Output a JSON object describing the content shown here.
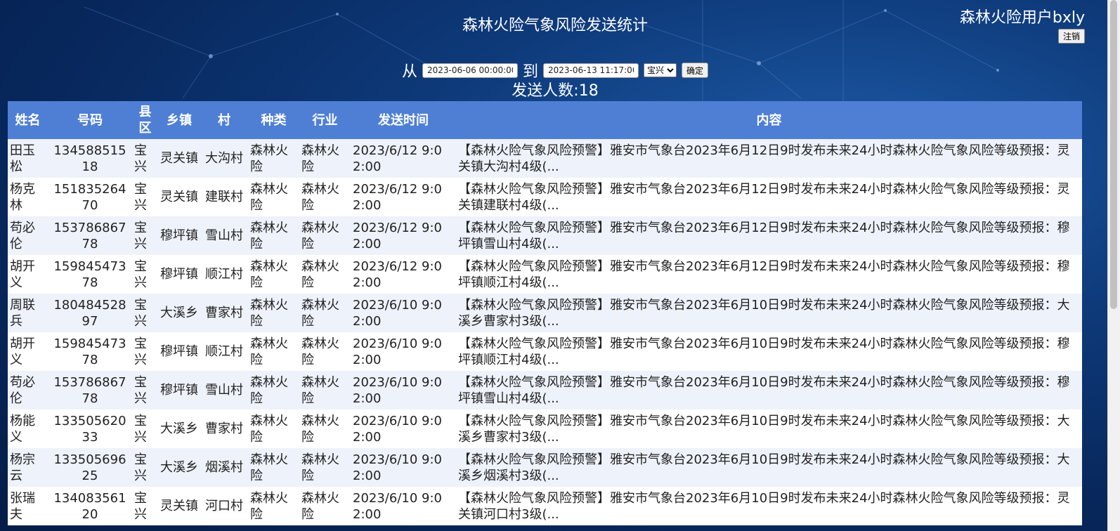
{
  "page": {
    "title": "森林火险气象风险发送统计",
    "user_name": "森林火险用户bxly",
    "logout_label": "注销"
  },
  "filter": {
    "from_label": "从",
    "to_label": "到",
    "start_value": "2023-06-06 00:00:00",
    "end_value": "2023-06-13 11:17:00",
    "county_selected": "宝兴",
    "confirm_label": "确定"
  },
  "summary": {
    "count_text": "发送人数:18"
  },
  "table": {
    "headers": [
      "姓名",
      "号码",
      "县区",
      "乡镇",
      "村",
      "种类",
      "行业",
      "发送时间",
      "内容"
    ],
    "rows": [
      {
        "name": "田玉松",
        "phone": "13458851518",
        "county": "宝兴",
        "town": "灵关镇",
        "village": "大沟村",
        "kind": "森林火险",
        "industry": "森林火险",
        "time": "2023/6/12 9:02:00",
        "content": "【森林火险气象风险预警】雅安市气象台2023年6月12日9时发布未来24小时森林火险气象风险等级预报：灵关镇大沟村4级(..."
      },
      {
        "name": "杨克林",
        "phone": "15183526470",
        "county": "宝兴",
        "town": "灵关镇",
        "village": "建联村",
        "kind": "森林火险",
        "industry": "森林火险",
        "time": "2023/6/12 9:02:00",
        "content": "【森林火险气象风险预警】雅安市气象台2023年6月12日9时发布未来24小时森林火险气象风险等级预报：灵关镇建联村4级(..."
      },
      {
        "name": "苟必伦",
        "phone": "15378686778",
        "county": "宝兴",
        "town": "穆坪镇",
        "village": "雪山村",
        "kind": "森林火险",
        "industry": "森林火险",
        "time": "2023/6/12 9:02:00",
        "content": "【森林火险气象风险预警】雅安市气象台2023年6月12日9时发布未来24小时森林火险气象风险等级预报：穆坪镇雪山村4级(..."
      },
      {
        "name": "胡开义",
        "phone": "15984547378",
        "county": "宝兴",
        "town": "穆坪镇",
        "village": "顺江村",
        "kind": "森林火险",
        "industry": "森林火险",
        "time": "2023/6/12 9:02:00",
        "content": "【森林火险气象风险预警】雅安市气象台2023年6月12日9时发布未来24小时森林火险气象风险等级预报：穆坪镇顺江村4级(..."
      },
      {
        "name": "周联兵",
        "phone": "18048452897",
        "county": "宝兴",
        "town": "大溪乡",
        "village": "曹家村",
        "kind": "森林火险",
        "industry": "森林火险",
        "time": "2023/6/10 9:02:00",
        "content": "【森林火险气象风险预警】雅安市气象台2023年6月10日9时发布未来24小时森林火险气象风险等级预报：大溪乡曹家村3级(..."
      },
      {
        "name": "胡开义",
        "phone": "15984547378",
        "county": "宝兴",
        "town": "穆坪镇",
        "village": "顺江村",
        "kind": "森林火险",
        "industry": "森林火险",
        "time": "2023/6/10 9:02:00",
        "content": "【森林火险气象风险预警】雅安市气象台2023年6月10日9时发布未来24小时森林火险气象风险等级预报：穆坪镇顺江村4级(..."
      },
      {
        "name": "苟必伦",
        "phone": "15378686778",
        "county": "宝兴",
        "town": "穆坪镇",
        "village": "雪山村",
        "kind": "森林火险",
        "industry": "森林火险",
        "time": "2023/6/10 9:02:00",
        "content": "【森林火险气象风险预警】雅安市气象台2023年6月10日9时发布未来24小时森林火险气象风险等级预报：穆坪镇雪山村4级(..."
      },
      {
        "name": "杨能义",
        "phone": "13350562033",
        "county": "宝兴",
        "town": "大溪乡",
        "village": "曹家村",
        "kind": "森林火险",
        "industry": "森林火险",
        "time": "2023/6/10 9:02:00",
        "content": "【森林火险气象风险预警】雅安市气象台2023年6月10日9时发布未来24小时森林火险气象风险等级预报：大溪乡曹家村3级(..."
      },
      {
        "name": "杨宗云",
        "phone": "13350569625",
        "county": "宝兴",
        "town": "大溪乡",
        "village": "烟溪村",
        "kind": "森林火险",
        "industry": "森林火险",
        "time": "2023/6/10 9:02:00",
        "content": "【森林火险气象风险预警】雅安市气象台2023年6月10日9时发布未来24小时森林火险气象风险等级预报：大溪乡烟溪村3级(..."
      },
      {
        "name": "张瑞夫",
        "phone": "13408356120",
        "county": "宝兴",
        "town": "灵关镇",
        "village": "河口村",
        "kind": "森林火险",
        "industry": "森林火险",
        "time": "2023/6/10 9:02:00",
        "content": "【森林火险气象风险预警】雅安市气象台2023年6月10日9时发布未来24小时森林火险气象风险等级预报：灵关镇河口村3级(..."
      }
    ]
  }
}
